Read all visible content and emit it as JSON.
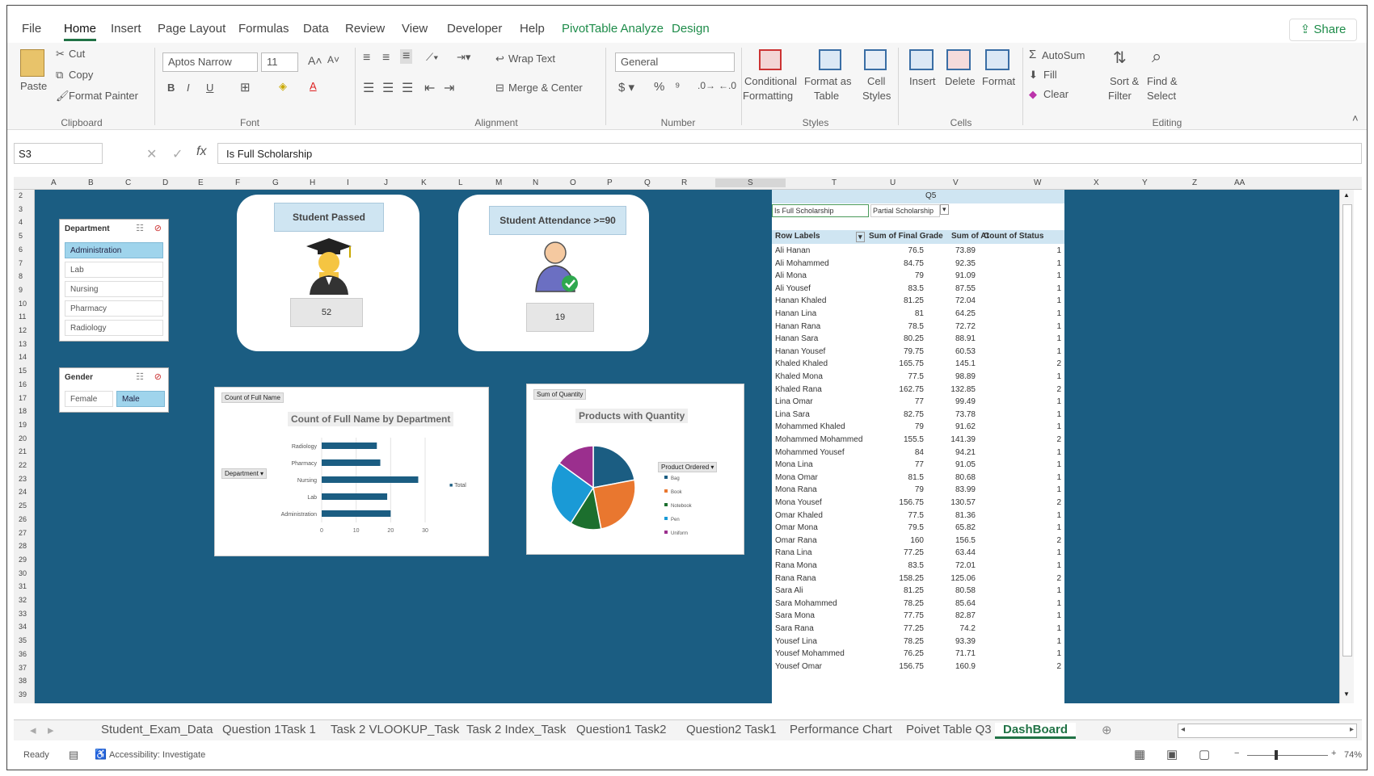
{
  "menu": {
    "items": [
      "File",
      "Home",
      "Insert",
      "Page Layout",
      "Formulas",
      "Data",
      "Review",
      "View",
      "Developer",
      "Help",
      "PivotTable Analyze",
      "Design"
    ],
    "share": "Share"
  },
  "ribbon": {
    "paste": "Paste",
    "cut": "Cut",
    "copy": "Copy",
    "format_painter": "Format Painter",
    "clipboard": "Clipboard",
    "font_name": "Aptos Narrow",
    "font_size": "11",
    "font": "Font",
    "wrap": "Wrap Text",
    "merge": "Merge & Center",
    "alignment": "Alignment",
    "number_format": "General",
    "number": "Number",
    "cond1": "Conditional",
    "cond2": "Formatting",
    "fmt1": "Format as",
    "fmt2": "Table",
    "cell1": "Cell",
    "cell2": "Styles",
    "styles": "Styles",
    "insert": "Insert",
    "delete": "Delete",
    "format": "Format",
    "cells": "Cells",
    "autosum": "AutoSum",
    "fill": "Fill",
    "clear": "Clear",
    "sort1": "Sort &",
    "sort2": "Filter",
    "find1": "Find &",
    "find2": "Select",
    "editing": "Editing"
  },
  "formula": {
    "namebox": "S3",
    "content": "Is Full Scholarship"
  },
  "columns": [
    "A",
    "B",
    "C",
    "D",
    "E",
    "F",
    "G",
    "H",
    "I",
    "J",
    "K",
    "L",
    "M",
    "N",
    "O",
    "P",
    "Q",
    "R",
    "S",
    "T",
    "U",
    "V",
    "W",
    "X",
    "Y",
    "Z",
    "AA"
  ],
  "rows": [
    "2",
    "3",
    "4",
    "5",
    "6",
    "7",
    "8",
    "9",
    "10",
    "11",
    "12",
    "13",
    "14",
    "15",
    "16",
    "17",
    "18",
    "19",
    "20",
    "21",
    "22",
    "23",
    "24",
    "25",
    "26",
    "27",
    "28",
    "29",
    "30",
    "31",
    "32",
    "33",
    "34",
    "35",
    "36",
    "37",
    "38",
    "39"
  ],
  "slicers": {
    "department": {
      "title": "Department",
      "items": [
        "Administration",
        "Lab",
        "Nursing",
        "Pharmacy",
        "Radiology"
      ]
    },
    "gender": {
      "title": "Gender",
      "items": [
        "Female",
        "Male"
      ]
    }
  },
  "cards": {
    "passed": {
      "title": "Student Passed",
      "value": "52"
    },
    "attendance": {
      "title": "Student Attendance >=90",
      "value": "19"
    }
  },
  "bar_chart": {
    "tag": "Count of Full Name",
    "title": "Count of Full Name by Department",
    "filter": "Department",
    "legend": "Total"
  },
  "pie_chart": {
    "tag": "Sum of Quantity",
    "title": "Products with Quantity",
    "legend_title": "Product Ordered",
    "legend": [
      "Bag",
      "Book",
      "Notebook",
      "Pen",
      "Uniform"
    ]
  },
  "chart_data": [
    {
      "type": "bar",
      "title": "Count of Full Name by Department",
      "categories": [
        "Radiology",
        "Pharmacy",
        "Nursing",
        "Lab",
        "Administration"
      ],
      "values": [
        16,
        17,
        28,
        19,
        20
      ],
      "xlim": [
        0,
        30
      ],
      "xticks": [
        "0",
        "10",
        "20",
        "30"
      ],
      "series": [
        {
          "name": "Total",
          "values": [
            16,
            17,
            28,
            19,
            20
          ]
        }
      ]
    },
    {
      "type": "pie",
      "title": "Products with Quantity",
      "categories": [
        "Bag",
        "Book",
        "Notebook",
        "Pen",
        "Uniform"
      ],
      "values": [
        22,
        25,
        12,
        26,
        15
      ]
    }
  ],
  "pivot": {
    "top": "Q5",
    "filter_label": "Is Full Scholarship",
    "filter_value": "Partial Scholarship",
    "headers": [
      "Row Labels",
      "Sum of Final Grade",
      "Sum of At",
      "Count of Status"
    ],
    "rows": [
      [
        "Ali Hanan",
        "76.5",
        "73.89",
        "1"
      ],
      [
        "Ali Mohammed",
        "84.75",
        "92.35",
        "1"
      ],
      [
        "Ali Mona",
        "79",
        "91.09",
        "1"
      ],
      [
        "Ali Yousef",
        "83.5",
        "87.55",
        "1"
      ],
      [
        "Hanan Khaled",
        "81.25",
        "72.04",
        "1"
      ],
      [
        "Hanan Lina",
        "81",
        "64.25",
        "1"
      ],
      [
        "Hanan Rana",
        "78.5",
        "72.72",
        "1"
      ],
      [
        "Hanan Sara",
        "80.25",
        "88.91",
        "1"
      ],
      [
        "Hanan Yousef",
        "79.75",
        "60.53",
        "1"
      ],
      [
        "Khaled Khaled",
        "165.75",
        "145.1",
        "2"
      ],
      [
        "Khaled Mona",
        "77.5",
        "98.89",
        "1"
      ],
      [
        "Khaled Rana",
        "162.75",
        "132.85",
        "2"
      ],
      [
        "Lina Omar",
        "77",
        "99.49",
        "1"
      ],
      [
        "Lina Sara",
        "82.75",
        "73.78",
        "1"
      ],
      [
        "Mohammed Khaled",
        "79",
        "91.62",
        "1"
      ],
      [
        "Mohammed Mohammed",
        "155.5",
        "141.39",
        "2"
      ],
      [
        "Mohammed Yousef",
        "84",
        "94.21",
        "1"
      ],
      [
        "Mona Lina",
        "77",
        "91.05",
        "1"
      ],
      [
        "Mona Omar",
        "81.5",
        "80.68",
        "1"
      ],
      [
        "Mona Rana",
        "79",
        "83.99",
        "1"
      ],
      [
        "Mona Yousef",
        "156.75",
        "130.57",
        "2"
      ],
      [
        "Omar Khaled",
        "77.5",
        "81.36",
        "1"
      ],
      [
        "Omar Mona",
        "79.5",
        "65.82",
        "1"
      ],
      [
        "Omar Rana",
        "160",
        "156.5",
        "2"
      ],
      [
        "Rana Lina",
        "77.25",
        "63.44",
        "1"
      ],
      [
        "Rana Mona",
        "83.5",
        "72.01",
        "1"
      ],
      [
        "Rana Rana",
        "158.25",
        "125.06",
        "2"
      ],
      [
        "Sara Ali",
        "81.25",
        "80.58",
        "1"
      ],
      [
        "Sara Mohammed",
        "78.25",
        "85.64",
        "1"
      ],
      [
        "Sara Mona",
        "77.75",
        "82.87",
        "1"
      ],
      [
        "Sara Rana",
        "77.25",
        "74.2",
        "1"
      ],
      [
        "Yousef Lina",
        "78.25",
        "93.39",
        "1"
      ],
      [
        "Yousef Mohammed",
        "76.25",
        "71.71",
        "1"
      ],
      [
        "Yousef Omar",
        "156.75",
        "160.9",
        "2"
      ]
    ]
  },
  "tabs": [
    "Student_Exam_Data",
    "Question 1Task 1",
    "Task 2 VLOOKUP_Task",
    "Task 2 Index_Task",
    "Question1 Task2",
    "Question2 Task1",
    "Performance Chart",
    "Poivet Table Q3",
    "DashBoard"
  ],
  "status": {
    "ready": "Ready",
    "accessibility": "Accessibility: Investigate",
    "zoom": "74%"
  },
  "colors": {
    "canvas": "#1b5d82",
    "excel_green": "#217346",
    "pie": [
      "#1b5d82",
      "#e9772f",
      "#1c6f2e",
      "#1a9ad6",
      "#9b2f8e"
    ]
  }
}
